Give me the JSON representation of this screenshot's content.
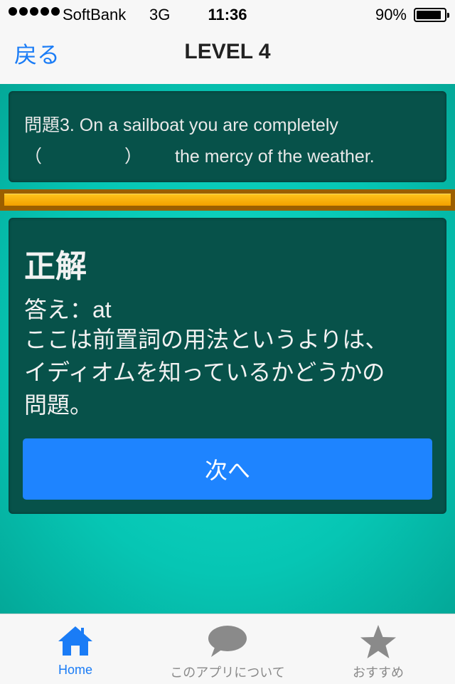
{
  "status": {
    "carrier": "SoftBank",
    "network": "3G",
    "time": "11:36",
    "battery_percent": "90%",
    "battery_level": 0.9
  },
  "nav": {
    "back_label": "戻る",
    "title": "LEVEL 4"
  },
  "question": {
    "line1": "問題3. On a sailboat you are completely",
    "paren_open": "（",
    "paren_close": "）",
    "line2_rest": "the mercy of the weather."
  },
  "progress": {
    "value": 1.0,
    "color": "#f5a800"
  },
  "answer": {
    "result": "正解",
    "answer_line": "答え：at",
    "explanation_lines": [
      "ここは前置詞の用法というよりは、",
      "イディオムを知っているかどうかの",
      "問題。"
    ],
    "next_label": "次へ"
  },
  "tabs": [
    {
      "label": "Home",
      "icon": "home-icon",
      "selected": true
    },
    {
      "label": "このアプリについて",
      "icon": "speech-bubble-icon",
      "selected": false
    },
    {
      "label": "おすすめ",
      "icon": "star-icon",
      "selected": false
    }
  ],
  "colors": {
    "accent": "#1a7cf6",
    "panel": "#07524a",
    "background": "#06c6b4",
    "button": "#1e84ff"
  }
}
